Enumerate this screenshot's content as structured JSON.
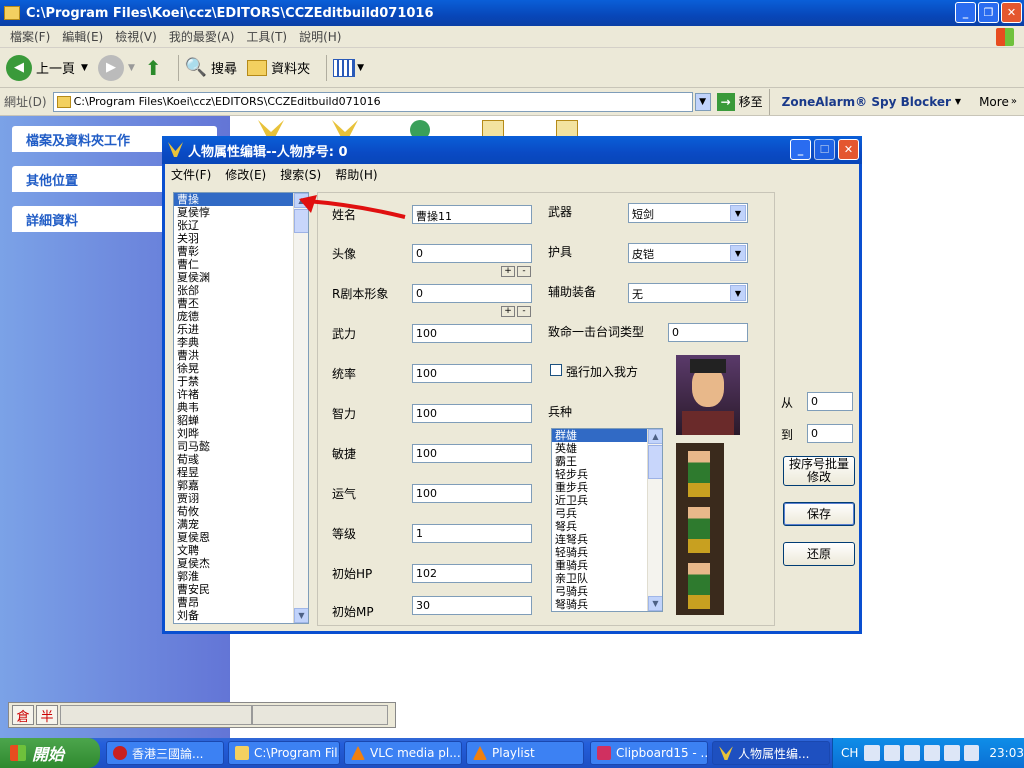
{
  "explorer": {
    "title": "C:\\Program Files\\Koei\\ccz\\EDITORS\\CCZEditbuild071016",
    "menu": [
      "檔案(F)",
      "編輯(E)",
      "檢視(V)",
      "我的最愛(A)",
      "工具(T)",
      "說明(H)"
    ],
    "toolbar": {
      "back": "上一頁",
      "search": "搜尋",
      "folders": "資料夾"
    },
    "address_label": "網址(D)",
    "address_value": "C:\\Program Files\\Koei\\ccz\\EDITORS\\CCZEditbuild071016",
    "go_label": "移至",
    "zonealarm": "ZoneAlarm® Spy Blocker",
    "more": "More",
    "left_pane": [
      "檔案及資料夾工作",
      "其他位置",
      "詳細資料"
    ]
  },
  "ime": {
    "mode1": "倉",
    "mode2": "半"
  },
  "dialog": {
    "title": "人物属性编辑--人物序号: 0",
    "menu": [
      "文件(F)",
      "修改(E)",
      "搜索(S)",
      "帮助(H)"
    ],
    "characters": [
      "曹操",
      "夏侯惇",
      "张辽",
      "关羽",
      "曹彰",
      "曹仁",
      "夏侯渊",
      "张郃",
      "曹丕",
      "庞德",
      "乐进",
      "李典",
      "曹洪",
      "徐晃",
      "于禁",
      "许褚",
      "典韦",
      "貂蝉",
      "刘晔",
      "司马懿",
      "荀彧",
      "程昱",
      "郭嘉",
      "贾诩",
      "荀攸",
      "满宠",
      "夏侯恩",
      "文聘",
      "夏侯杰",
      "郭淮",
      "曹安民",
      "曹昂",
      "刘备"
    ],
    "selected_character": 0,
    "labels": {
      "name": "姓名",
      "head": "头像",
      "r_image": "R剧本形象",
      "force": "武力",
      "command": "统率",
      "intelligence": "智力",
      "agility": "敏捷",
      "luck": "运气",
      "level": "等级",
      "init_hp": "初始HP",
      "init_mp": "初始MP",
      "weapon": "武器",
      "armor": "护具",
      "aux": "辅助装备",
      "crit_type": "致命一击台词类型",
      "force_join": "强行加入我方",
      "troop_type": "兵种"
    },
    "values": {
      "name": "曹操11",
      "head": "0",
      "r_image": "0",
      "force": "100",
      "command": "100",
      "intelligence": "100",
      "agility": "100",
      "luck": "100",
      "level": "1",
      "init_hp": "102",
      "init_mp": "30",
      "weapon": "短剑",
      "armor": "皮铠",
      "aux": "无",
      "crit_type": "0"
    },
    "stepper": {
      "plus": "+",
      "minus": "-"
    },
    "troops": [
      "群雄",
      "英雄",
      "霸王",
      "轻步兵",
      "重步兵",
      "近卫兵",
      "弓兵",
      "弩兵",
      "连弩兵",
      "轻骑兵",
      "重骑兵",
      "亲卫队",
      "弓骑兵",
      "弩骑兵"
    ],
    "selected_troop": 0,
    "range": {
      "from_label": "从",
      "from_value": "0",
      "to_label": "到",
      "to_value": "0"
    },
    "buttons": {
      "batch": "按序号批量修改",
      "save": "保存",
      "restore": "还原"
    }
  },
  "taskbar": {
    "start": "開始",
    "tasks": [
      "香港三國論...",
      "C:\\Program Fil...",
      "VLC media pl...",
      "Playlist",
      "Clipboard15 - ...",
      "人物属性编..."
    ],
    "lang": "CH",
    "clock": "23:03"
  }
}
